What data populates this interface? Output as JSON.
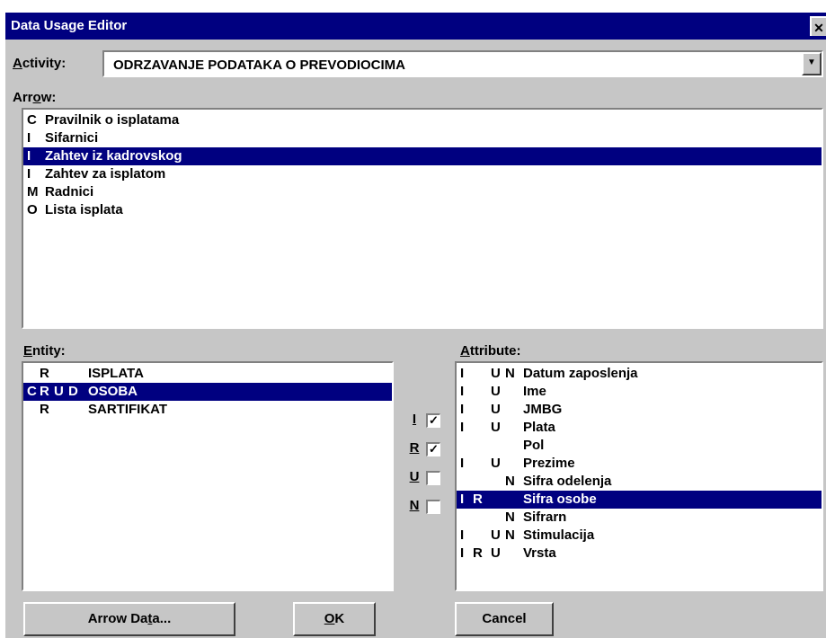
{
  "window": {
    "title": "Data Usage Editor",
    "close_glyph": "✕"
  },
  "activity": {
    "label_mnemonic": "A",
    "label_rest": "ctivity:",
    "value": "ODRZAVANJE PODATAKA O PREVODIOCIMA",
    "dropdown_glyph": "▼"
  },
  "arrow": {
    "label_pre": "Arr",
    "label_mnemonic": "o",
    "label_post": "w:",
    "items": [
      {
        "code": "C",
        "name": "Pravilnik o isplatama",
        "selected": false
      },
      {
        "code": "I",
        "name": "Sifarnici",
        "selected": false
      },
      {
        "code": "I",
        "name": "Zahtev iz kadrovskog",
        "selected": true
      },
      {
        "code": "I",
        "name": "Zahtev za isplatom",
        "selected": false
      },
      {
        "code": "M",
        "name": "Radnici",
        "selected": false
      },
      {
        "code": "O",
        "name": "Lista isplata",
        "selected": false
      }
    ]
  },
  "entity": {
    "label_mnemonic": "E",
    "label_rest": "ntity:",
    "items": [
      {
        "c": "",
        "r": "R",
        "u": "",
        "d": "",
        "name": "ISPLATA",
        "selected": false
      },
      {
        "c": "C",
        "r": "R",
        "u": "U",
        "d": "D",
        "name": "OSOBA",
        "selected": true
      },
      {
        "c": "",
        "r": "R",
        "u": "",
        "d": "",
        "name": "SARTIFIKAT",
        "selected": false
      }
    ]
  },
  "flags": [
    {
      "label": "I",
      "checked": true,
      "mark": "✓"
    },
    {
      "label": "R",
      "checked": true,
      "mark": "✓"
    },
    {
      "label": "U",
      "checked": false,
      "mark": ""
    },
    {
      "label": "N",
      "checked": false,
      "mark": ""
    }
  ],
  "attribute": {
    "label_mnemonic": "A",
    "label_rest": "ttribute:",
    "items": [
      {
        "i": "I",
        "r": "",
        "u": "U",
        "n": "N",
        "name": "Datum zaposlenja",
        "selected": false
      },
      {
        "i": "I",
        "r": "",
        "u": "U",
        "n": "",
        "name": "Ime",
        "selected": false
      },
      {
        "i": "I",
        "r": "",
        "u": "U",
        "n": "",
        "name": "JMBG",
        "selected": false
      },
      {
        "i": "I",
        "r": "",
        "u": "U",
        "n": "",
        "name": "Plata",
        "selected": false
      },
      {
        "i": "",
        "r": "",
        "u": "",
        "n": "",
        "name": "Pol",
        "selected": false
      },
      {
        "i": "I",
        "r": "",
        "u": "U",
        "n": "",
        "name": "Prezime",
        "selected": false
      },
      {
        "i": "",
        "r": "",
        "u": "",
        "n": "N",
        "name": "Sifra odelenja",
        "selected": false
      },
      {
        "i": "I",
        "r": "R",
        "u": "",
        "n": "",
        "name": "Sifra osobe",
        "selected": true
      },
      {
        "i": "",
        "r": "",
        "u": "",
        "n": "N",
        "name": "Sifrarn",
        "selected": false
      },
      {
        "i": "I",
        "r": "",
        "u": "U",
        "n": "N",
        "name": "Stimulacija",
        "selected": false
      },
      {
        "i": "I",
        "r": "R",
        "u": "U",
        "n": "",
        "name": "Vrsta",
        "selected": false
      }
    ]
  },
  "buttons": {
    "arrow_data_pre": "Arrow Da",
    "arrow_data_mnemonic": "t",
    "arrow_data_post": "a...",
    "ok_mnemonic": "O",
    "ok_rest": "K",
    "cancel": "Cancel"
  }
}
